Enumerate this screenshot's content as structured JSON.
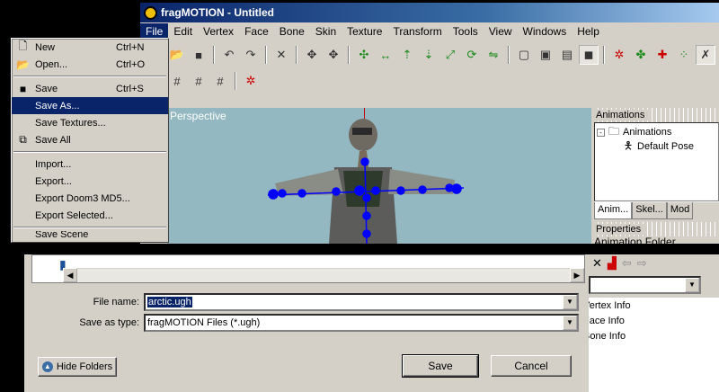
{
  "app": {
    "title": "fragMOTION - Untitled",
    "menus": [
      "File",
      "Edit",
      "Vertex",
      "Face",
      "Bone",
      "Skin",
      "Texture",
      "Transform",
      "Tools",
      "View",
      "Windows",
      "Help"
    ],
    "active_menu": "File"
  },
  "viewport": {
    "label": "Perspective"
  },
  "animations_panel": {
    "title": "Animations",
    "tree": [
      {
        "label": "Animations",
        "expander": "-"
      },
      {
        "label": "Default Pose"
      }
    ],
    "tabs": [
      "Anim...",
      "Skel...",
      "Mod"
    ]
  },
  "properties_panel": {
    "title": "Properties",
    "partial_row": "Animation Folder"
  },
  "file_menu": {
    "items": [
      {
        "label": "New",
        "shortcut": "Ctrl+N",
        "icon": "new-file-icon"
      },
      {
        "label": "Open...",
        "shortcut": "Ctrl+O",
        "icon": "open-folder-icon"
      },
      {
        "sep": true
      },
      {
        "label": "Save",
        "shortcut": "Ctrl+S",
        "icon": "save-disk-icon"
      },
      {
        "label": "Save As...",
        "shortcut": "",
        "highlighted": true
      },
      {
        "label": "Save Textures...",
        "shortcut": ""
      },
      {
        "label": "Save All",
        "shortcut": "",
        "icon": "save-all-icon"
      },
      {
        "sep": true
      },
      {
        "label": "Import...",
        "shortcut": ""
      },
      {
        "label": "Export...",
        "shortcut": ""
      },
      {
        "label": "Export Doom3 MD5...",
        "shortcut": ""
      },
      {
        "label": "Export Selected...",
        "shortcut": ""
      }
    ],
    "partial_item": "Save Scene"
  },
  "save_dialog": {
    "file_name_label": "File name:",
    "file_name_value": "arctic.ugh",
    "save_type_label": "Save as type:",
    "save_type_value": "fragMOTION Files (*.ugh)",
    "hide_folders": "Hide Folders",
    "save": "Save",
    "cancel": "Cancel"
  },
  "background_list": {
    "items": [
      "Vertex Info",
      "Face Info",
      "Bone Info"
    ]
  },
  "colors": {
    "title_bar": "#0a246a",
    "viewport_bg": "#93b8c1",
    "skeleton": "#0000ff",
    "highlight": "#0a246a"
  }
}
